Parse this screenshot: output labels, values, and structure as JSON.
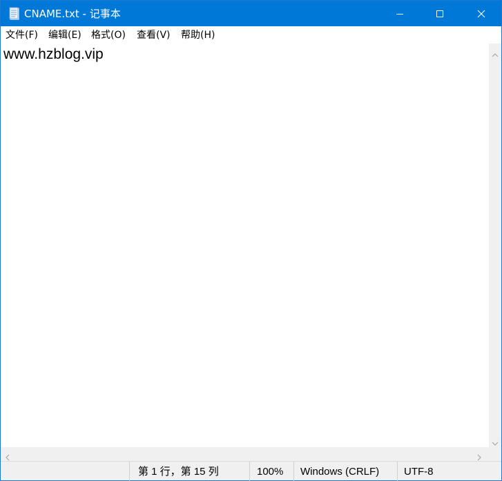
{
  "window": {
    "title": "CNAME.txt - 记事本",
    "icon": "notepad-icon",
    "controls": {
      "minimize_icon": "minimize-icon",
      "maximize_icon": "maximize-icon",
      "close_icon": "close-icon"
    },
    "accent_color": "#0078d7"
  },
  "menu": {
    "items": [
      {
        "label": "文件(F)"
      },
      {
        "label": "编辑(E)"
      },
      {
        "label": "格式(O)"
      },
      {
        "label": "查看(V)"
      },
      {
        "label": "帮助(H)"
      }
    ]
  },
  "editor": {
    "text": "www.hzblog.vip"
  },
  "statusbar": {
    "position": "第 1 行，第 15 列",
    "zoom": "100%",
    "line_ending": "Windows (CRLF)",
    "encoding": "UTF-8"
  }
}
